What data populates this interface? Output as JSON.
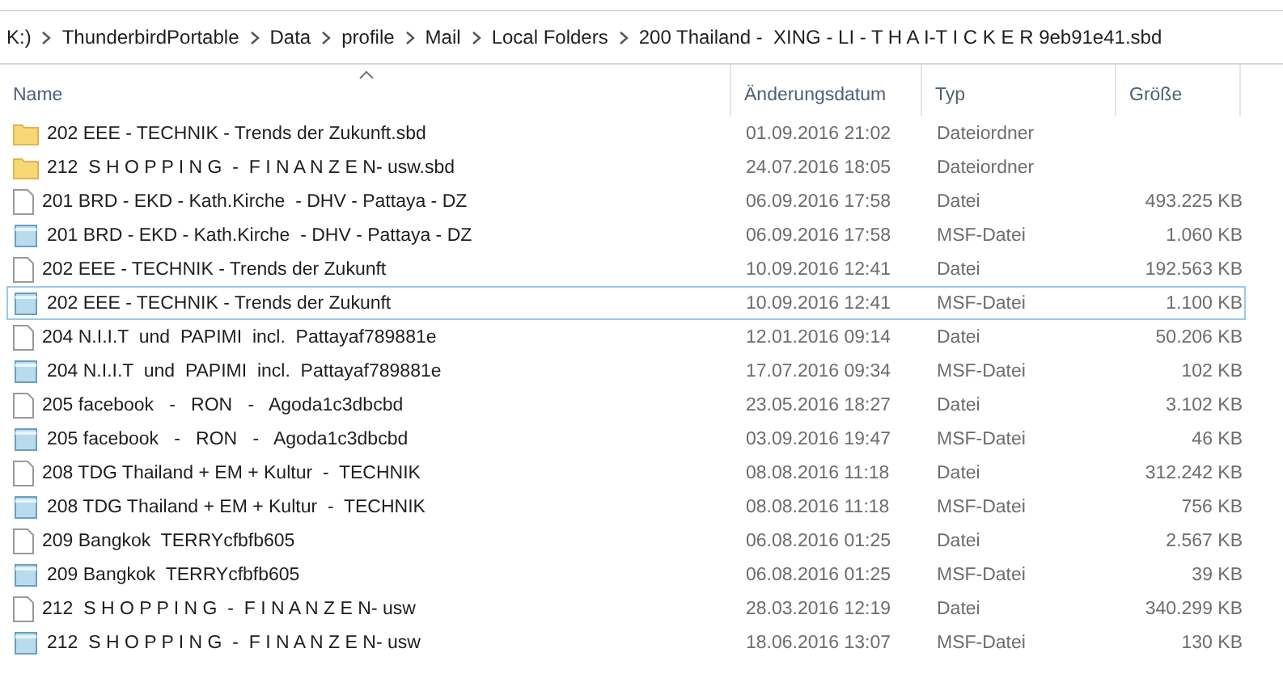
{
  "breadcrumb": [
    "K:)",
    "ThunderbirdPortable",
    "Data",
    "profile",
    "Mail",
    "Local Folders",
    "200 Thailand -  XING - LI - T H A I-T I C K E R 9eb91e41.sbd"
  ],
  "columns": [
    {
      "label": "Name",
      "sorted": true
    },
    {
      "label": "Änderungsdatum",
      "sorted": false
    },
    {
      "label": "Typ",
      "sorted": false
    },
    {
      "label": "Größe",
      "sorted": false
    }
  ],
  "rows": [
    {
      "kind": "folder",
      "name": "202 EEE - TECHNIK - Trends der Zukunft.sbd",
      "date": "01.09.2016 21:02",
      "type": "Dateiordner",
      "focused": false
    },
    {
      "kind": "folder",
      "name": "212  S H O P P I N G  -  F I N A N Z E N- usw.sbd",
      "date": "24.07.2016 18:05",
      "type": "Dateiordner",
      "focused": false
    },
    {
      "kind": "file",
      "name": "201 BRD - EKD - Kath.Kirche  - DHV - Pattaya - DZ",
      "date": "06.09.2016 17:58",
      "type": "Datei",
      "size": "493.225 KB",
      "focused": false
    },
    {
      "kind": "msf",
      "name": "201 BRD - EKD - Kath.Kirche  - DHV - Pattaya - DZ",
      "date": "06.09.2016 17:58",
      "type": "MSF-Datei",
      "size": "1.060 KB",
      "focused": false
    },
    {
      "kind": "file",
      "name": "202 EEE - TECHNIK - Trends der Zukunft",
      "date": "10.09.2016 12:41",
      "type": "Datei",
      "size": "192.563 KB",
      "focused": false
    },
    {
      "kind": "msf",
      "name": "202 EEE - TECHNIK - Trends der Zukunft",
      "date": "10.09.2016 12:41",
      "type": "MSF-Datei",
      "size": "1.100 KB",
      "focused": true
    },
    {
      "kind": "file",
      "name": "204 N.I.I.T  und  PAPIMI  incl.  Pattayaf789881e",
      "date": "12.01.2016 09:14",
      "type": "Datei",
      "size": "50.206 KB",
      "focused": false
    },
    {
      "kind": "msf",
      "name": "204 N.I.I.T  und  PAPIMI  incl.  Pattayaf789881e",
      "date": "17.07.2016 09:34",
      "type": "MSF-Datei",
      "size": "102 KB",
      "focused": false
    },
    {
      "kind": "file",
      "name": "205 facebook   -   RON   -   Agoda1c3dbcbd",
      "date": "23.05.2016 18:27",
      "type": "Datei",
      "size": "3.102 KB",
      "focused": false
    },
    {
      "kind": "msf",
      "name": "205 facebook   -   RON   -   Agoda1c3dbcbd",
      "date": "03.09.2016 19:47",
      "type": "MSF-Datei",
      "size": "46 KB",
      "focused": false
    },
    {
      "kind": "file",
      "name": "208 TDG Thailand + EM + Kultur  -  TECHNIK",
      "date": "08.08.2016 11:18",
      "type": "Datei",
      "size": "312.242 KB",
      "focused": false
    },
    {
      "kind": "msf",
      "name": "208 TDG Thailand + EM + Kultur  -  TECHNIK",
      "date": "08.08.2016 11:18",
      "type": "MSF-Datei",
      "size": "756 KB",
      "focused": false
    },
    {
      "kind": "file",
      "name": "209 Bangkok  TERRYcfbfb605",
      "date": "06.08.2016 01:25",
      "type": "Datei",
      "size": "2.567 KB",
      "focused": false
    },
    {
      "kind": "msf",
      "name": "209 Bangkok  TERRYcfbfb605",
      "date": "06.08.2016 01:25",
      "type": "MSF-Datei",
      "size": "39 KB",
      "focused": false
    },
    {
      "kind": "file",
      "name": "212  S H O P P I N G  -  F I N A N Z E N- usw",
      "date": "28.03.2016 12:19",
      "type": "Datei",
      "size": "340.299 KB",
      "focused": false
    },
    {
      "kind": "msf",
      "name": "212  S H O P P I N G  -  F I N A N Z E N- usw",
      "date": "18.06.2016 13:07",
      "type": "MSF-Datei",
      "size": "130 KB",
      "focused": false
    }
  ]
}
